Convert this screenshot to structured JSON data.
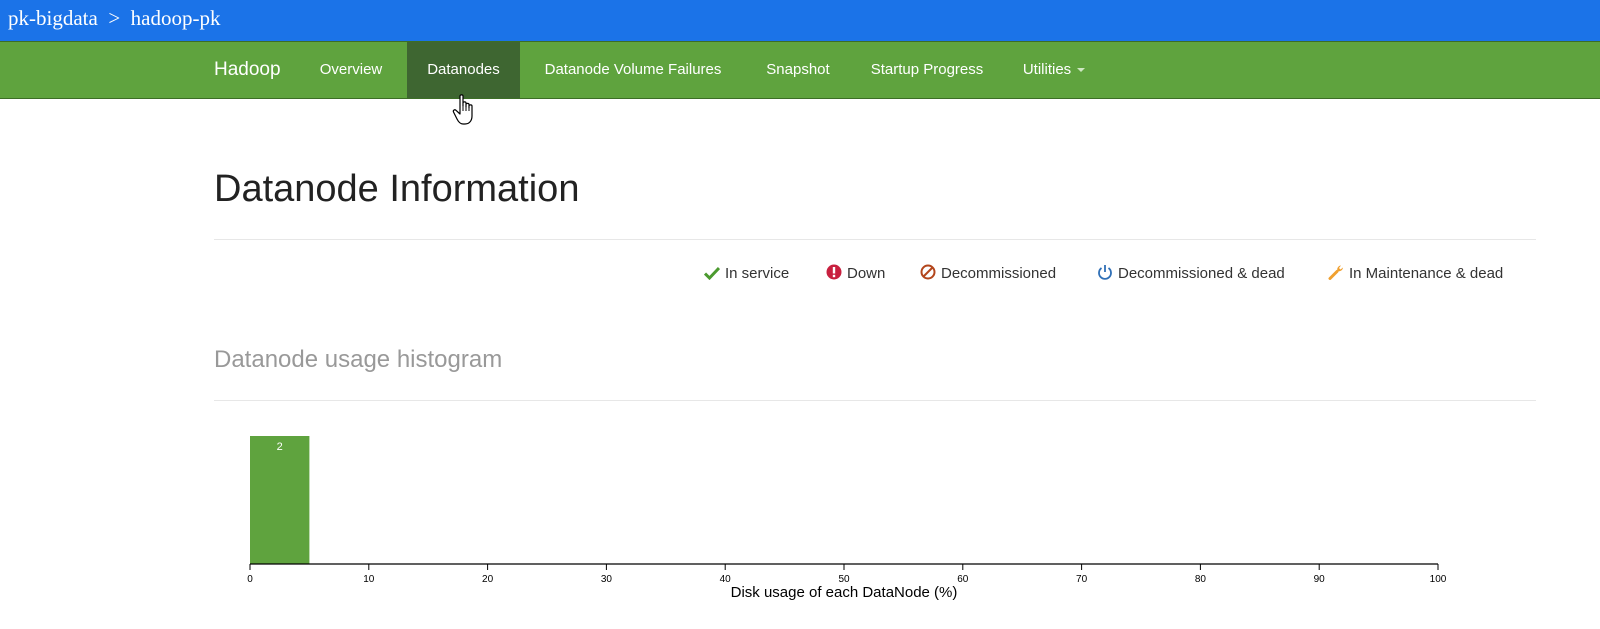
{
  "topbar": {
    "project": "pk-bigdata",
    "separator": ">",
    "cluster": "hadoop-pk"
  },
  "nav": {
    "brand": "Hadoop",
    "items": [
      {
        "label": "Overview",
        "active": false
      },
      {
        "label": "Datanodes",
        "active": true
      },
      {
        "label": "Datanode Volume Failures",
        "active": false
      },
      {
        "label": "Snapshot",
        "active": false
      },
      {
        "label": "Startup Progress",
        "active": false
      },
      {
        "label": "Utilities",
        "active": false,
        "dropdown": true
      }
    ]
  },
  "page_title": "Datanode Information",
  "legend": [
    {
      "label": "In service",
      "icon": "check-icon",
      "color": "#4b9a2f"
    },
    {
      "label": "Down",
      "icon": "exclamation-circle-icon",
      "color": "#c8203f"
    },
    {
      "label": "Decommissioned",
      "icon": "ban-icon",
      "color": "#b3461c"
    },
    {
      "label": "Decommissioned & dead",
      "icon": "power-icon",
      "color": "#2f6fb6"
    },
    {
      "label": "In Maintenance & dead",
      "icon": "wrench-icon",
      "color": "#f0a030"
    }
  ],
  "histogram_title": "Datanode usage histogram",
  "chart_data": {
    "type": "bar",
    "bins": [
      {
        "x0": 0,
        "x1": 5,
        "count": 2
      }
    ],
    "xlim": [
      0,
      100
    ],
    "xticks": [
      0,
      10,
      20,
      30,
      40,
      50,
      60,
      70,
      80,
      90,
      100
    ],
    "xlabel": "Disk usage of each DataNode (%)",
    "bar_color": "#5fa33e"
  }
}
